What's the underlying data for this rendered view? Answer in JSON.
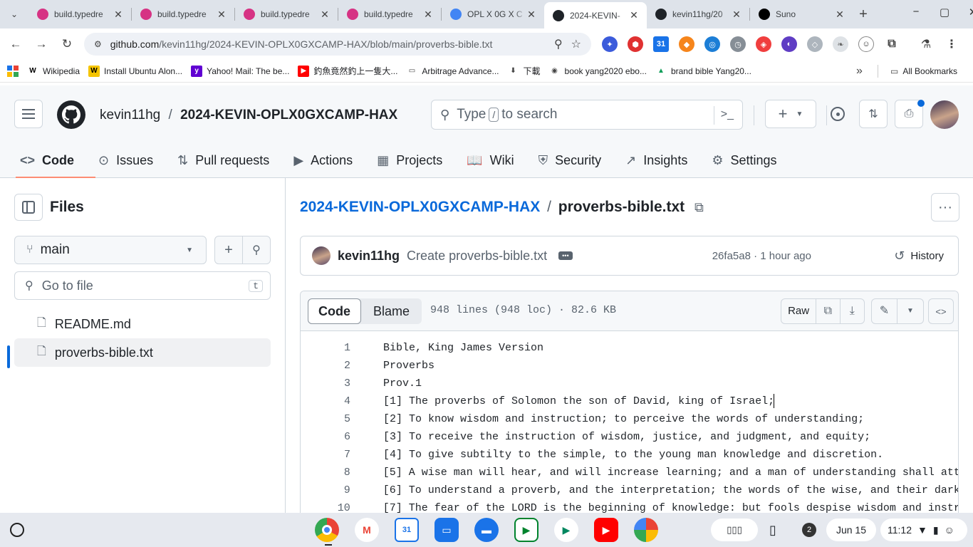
{
  "browser": {
    "tabs": [
      {
        "title": "build.typedre",
        "color": "#d63384"
      },
      {
        "title": "build.typedre",
        "color": "#d63384"
      },
      {
        "title": "build.typedre",
        "color": "#d63384"
      },
      {
        "title": "build.typedre",
        "color": "#d63384"
      },
      {
        "title": "OPL X 0G X C",
        "color": "#4285f4"
      },
      {
        "title": "2024-KEVIN-",
        "color": "#1f2328",
        "active": true
      },
      {
        "title": "kevin11hg/20",
        "color": "#1f2328"
      },
      {
        "title": "Suno",
        "color": "#000000"
      }
    ],
    "url_host": "github.com",
    "url_path": "/kevin11hg/2024-KEVIN-OPLX0GXCAMP-HAX/blob/main/proverbs-bible.txt",
    "bookmarks": [
      {
        "label": "Wikipedia",
        "icon": "W",
        "color": "#ffffff",
        "fg": "#000"
      },
      {
        "label": "Install Ubuntu Alon...",
        "icon": "W",
        "color": "#f5c400",
        "fg": "#000"
      },
      {
        "label": "Yahoo! Mail: The be...",
        "icon": "y",
        "color": "#6001d2",
        "fg": "#fff"
      },
      {
        "label": "釣魚竟然釣上一隻大...",
        "icon": "▶",
        "color": "#ff0000",
        "fg": "#fff"
      },
      {
        "label": "Arbitrage Advance...",
        "icon": "▭",
        "color": "#ffffff",
        "fg": "#444"
      },
      {
        "label": "下載",
        "icon": "⬇",
        "color": "#ffffff",
        "fg": "#444"
      },
      {
        "label": "book yang2020 ebo...",
        "icon": "◉",
        "color": "#ffffff",
        "fg": "#444"
      },
      {
        "label": "brand bible Yang20...",
        "icon": "▲",
        "color": "#ffffff",
        "fg": "#0f9d58"
      }
    ],
    "all_bookmarks": "All Bookmarks"
  },
  "github": {
    "owner": "kevin11hg",
    "repo": "2024-KEVIN-OPLX0GXCAMP-HAX",
    "search_prefix": "Type",
    "search_key": "/",
    "search_suffix": "to search",
    "nav": [
      "Code",
      "Issues",
      "Pull requests",
      "Actions",
      "Projects",
      "Wiki",
      "Security",
      "Insights",
      "Settings"
    ],
    "files_title": "Files",
    "branch": "main",
    "goto_placeholder": "Go to file",
    "goto_key": "t",
    "files": [
      "README.md",
      "proverbs-bible.txt"
    ],
    "breadcrumb_repo": "2024-KEVIN-OPLX0GXCAMP-HAX",
    "breadcrumb_sep": "/",
    "filename": "proverbs-bible.txt",
    "commit_author": "kevin11hg",
    "commit_message": "Create proverbs-bible.txt",
    "commit_meta": "26fa5a8 · 1 hour ago",
    "history": "History",
    "tab_code": "Code",
    "tab_blame": "Blame",
    "file_stats": "948 lines (948 loc) · 82.6 KB",
    "raw": "Raw",
    "lines": [
      {
        "n": "1",
        "t": "Bible, King James Version"
      },
      {
        "n": "2",
        "t": "Proverbs"
      },
      {
        "n": "3",
        "t": "Prov.1"
      },
      {
        "n": "4",
        "t": "[1] The proverbs of Solomon the son of David, king of Israel;"
      },
      {
        "n": "5",
        "t": "[2] To know wisdom and instruction; to perceive the words of understanding;"
      },
      {
        "n": "6",
        "t": "[3] To receive the instruction of wisdom, justice, and judgment, and equity;"
      },
      {
        "n": "7",
        "t": "[4] To give subtilty to the simple, to the young man knowledge and discretion."
      },
      {
        "n": "8",
        "t": "[5] A wise man will hear, and will increase learning; and a man of understanding shall att"
      },
      {
        "n": "9",
        "t": "[6] To understand a proverb, and the interpretation; the words of the wise, and their dark"
      },
      {
        "n": "10",
        "t": "[7] The fear of the LORD is the beginning of knowledge: but fools despise wisdom and instr"
      }
    ]
  },
  "shelf": {
    "notif_count": "2",
    "date": "Jun 15",
    "time": "11:12"
  }
}
